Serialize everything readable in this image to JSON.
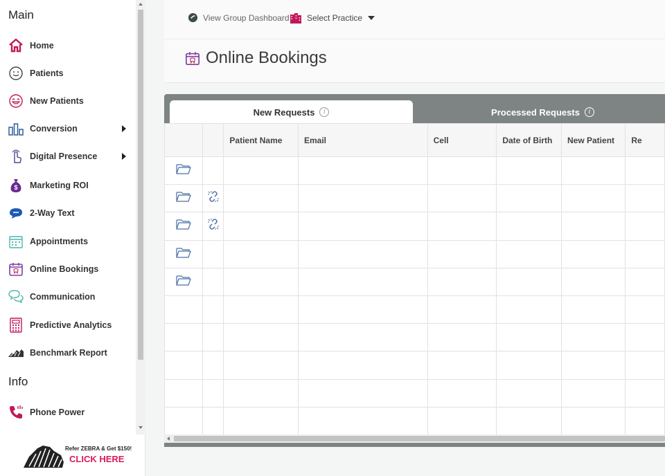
{
  "sidebar": {
    "main_title": "Main",
    "info_title": "Info",
    "items": [
      {
        "label": "Home",
        "icon": "home-icon",
        "submenu": false
      },
      {
        "label": "Patients",
        "icon": "patients-icon",
        "submenu": false
      },
      {
        "label": "New Patients",
        "icon": "new-patients-icon",
        "submenu": false
      },
      {
        "label": "Conversion",
        "icon": "conversion-icon",
        "submenu": true
      },
      {
        "label": "Digital Presence",
        "icon": "digital-presence-icon",
        "submenu": true
      },
      {
        "label": "Marketing ROI",
        "icon": "marketing-roi-icon",
        "submenu": false
      },
      {
        "label": "2-Way Text",
        "icon": "two-way-text-icon",
        "submenu": false
      },
      {
        "label": "Appointments",
        "icon": "appointments-icon",
        "submenu": false
      },
      {
        "label": "Online Bookings",
        "icon": "online-bookings-icon",
        "submenu": false
      },
      {
        "label": "Communication",
        "icon": "communication-icon",
        "submenu": false
      },
      {
        "label": "Predictive Analytics",
        "icon": "predictive-analytics-icon",
        "submenu": false
      },
      {
        "label": "Benchmark Report",
        "icon": "benchmark-report-icon",
        "submenu": false
      }
    ],
    "info_items": [
      {
        "label": "Phone Power",
        "icon": "phone-power-icon"
      }
    ],
    "refer": {
      "small": "Refer ZEBRA & Get $150!",
      "big": "CLICK HERE"
    }
  },
  "header": {
    "group_dashboard": "View Group Dashboard",
    "select_practice": "Select Practice",
    "page_title": "Online Bookings"
  },
  "tabs": {
    "new_requests": "New Requests",
    "processed_requests": "Processed Requests",
    "active": "new_requests"
  },
  "table": {
    "columns": [
      "",
      "",
      "Patient Name",
      "Email",
      "Cell",
      "Date of Birth",
      "New Patient",
      "Re"
    ],
    "rows": [
      {
        "folder": true,
        "unlink": false
      },
      {
        "folder": true,
        "unlink": true
      },
      {
        "folder": true,
        "unlink": true
      },
      {
        "folder": true,
        "unlink": false
      },
      {
        "folder": true,
        "unlink": false
      },
      {
        "folder": false,
        "unlink": false
      },
      {
        "folder": false,
        "unlink": false
      },
      {
        "folder": false,
        "unlink": false
      },
      {
        "folder": false,
        "unlink": false
      },
      {
        "folder": false,
        "unlink": false
      }
    ]
  },
  "colors": {
    "accent": "#d81b5a",
    "brand_purple": "#7b3fa0",
    "panel_gray": "#7e8484",
    "folder_blue": "#4a6fa5"
  }
}
